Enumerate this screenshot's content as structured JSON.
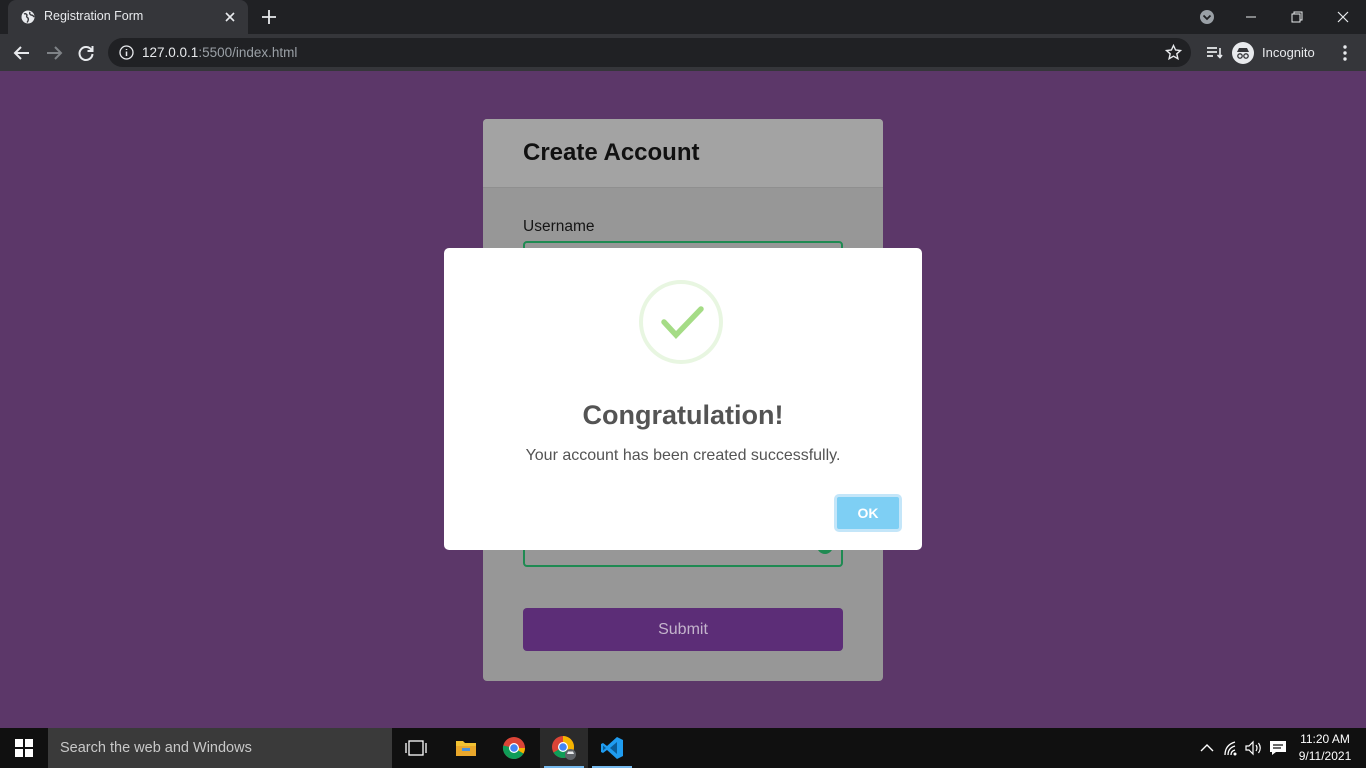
{
  "browser": {
    "tab_title": "Registration Form",
    "url_host": "127.0.0.1",
    "url_rest": ":5500/index.html",
    "profile_label": "Incognito"
  },
  "form": {
    "title": "Create Account",
    "username_label": "Username",
    "submit_label": "Submit"
  },
  "modal": {
    "title": "Congratulation!",
    "message": "Your account has been created successfully.",
    "ok_label": "OK"
  },
  "taskbar": {
    "search_placeholder": "Search the web and Windows",
    "time": "11:20 AM",
    "date": "9/11/2021"
  },
  "colors": {
    "page_background": "#5c3769",
    "submit_button": "#5c2d77",
    "ok_button": "#7ecff4",
    "success_check": "#a5dc86",
    "valid_border": "#1f8a52"
  }
}
